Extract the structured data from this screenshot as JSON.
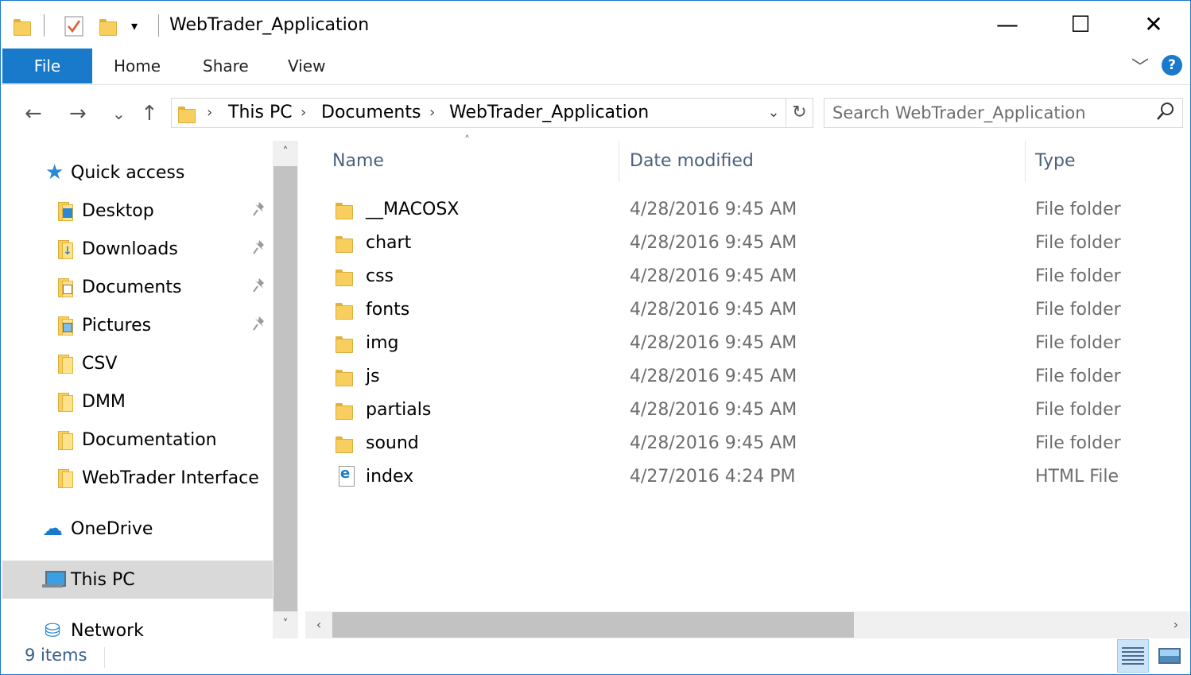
{
  "window": {
    "title": "WebTrader_Application",
    "minimize_glyph": "—",
    "maximize_glyph": "☐",
    "close_glyph": "✕",
    "accent_color": "#1979ca"
  },
  "quick_access_toolbar": {
    "icons": [
      "folder-icon",
      "properties-checkmark-icon",
      "new-folder-icon",
      "customize-dropdown-icon"
    ],
    "dropdown_glyph": "▾"
  },
  "ribbon": {
    "tabs": [
      "File",
      "Home",
      "Share",
      "View"
    ],
    "collapse_glyph": "﹀",
    "help_glyph": "?"
  },
  "address": {
    "back_glyph": "←",
    "forward_glyph": "→",
    "recent_glyph": "⌄",
    "up_glyph": "↑",
    "breadcrumbs": [
      "This PC",
      "Documents",
      "WebTrader_Application"
    ],
    "separator_glyph": "›",
    "dropdown_glyph": "⌄",
    "refresh_glyph": "↻"
  },
  "search": {
    "placeholder": "Search WebTrader_Application",
    "value": ""
  },
  "nav_pane": {
    "quick_access": "Quick access",
    "pinned": [
      {
        "label": "Desktop",
        "icon": "desktop-folder-icon"
      },
      {
        "label": "Downloads",
        "icon": "downloads-folder-icon"
      },
      {
        "label": "Documents",
        "icon": "documents-folder-icon"
      },
      {
        "label": "Pictures",
        "icon": "pictures-folder-icon"
      }
    ],
    "folders": [
      "CSV",
      "DMM",
      "Documentation",
      "WebTrader Interface"
    ],
    "onedrive": "OneDrive",
    "this_pc": "This PC",
    "network": "Network",
    "pin_glyph": "📌",
    "scroll_up_glyph": "˄",
    "scroll_down_glyph": "˅"
  },
  "columns": {
    "name": "Name",
    "date": "Date modified",
    "type": "Type",
    "sort_glyph": "˄"
  },
  "files": [
    {
      "name": "__MACOSX",
      "date": "4/28/2016 9:45 AM",
      "type": "File folder",
      "icon": "folder-icon"
    },
    {
      "name": "chart",
      "date": "4/28/2016 9:45 AM",
      "type": "File folder",
      "icon": "folder-icon"
    },
    {
      "name": "css",
      "date": "4/28/2016 9:45 AM",
      "type": "File folder",
      "icon": "folder-icon"
    },
    {
      "name": "fonts",
      "date": "4/28/2016 9:45 AM",
      "type": "File folder",
      "icon": "folder-icon"
    },
    {
      "name": "img",
      "date": "4/28/2016 9:45 AM",
      "type": "File folder",
      "icon": "folder-icon"
    },
    {
      "name": "js",
      "date": "4/28/2016 9:45 AM",
      "type": "File folder",
      "icon": "folder-icon"
    },
    {
      "name": "partials",
      "date": "4/28/2016 9:45 AM",
      "type": "File folder",
      "icon": "folder-icon"
    },
    {
      "name": "sound",
      "date": "4/28/2016 9:45 AM",
      "type": "File folder",
      "icon": "folder-icon"
    },
    {
      "name": "index",
      "date": "4/27/2016 4:24 PM",
      "type": "HTML File",
      "icon": "html-file-icon"
    }
  ],
  "hscroll": {
    "left_glyph": "‹",
    "right_glyph": "›"
  },
  "status": {
    "count": "9 items"
  }
}
